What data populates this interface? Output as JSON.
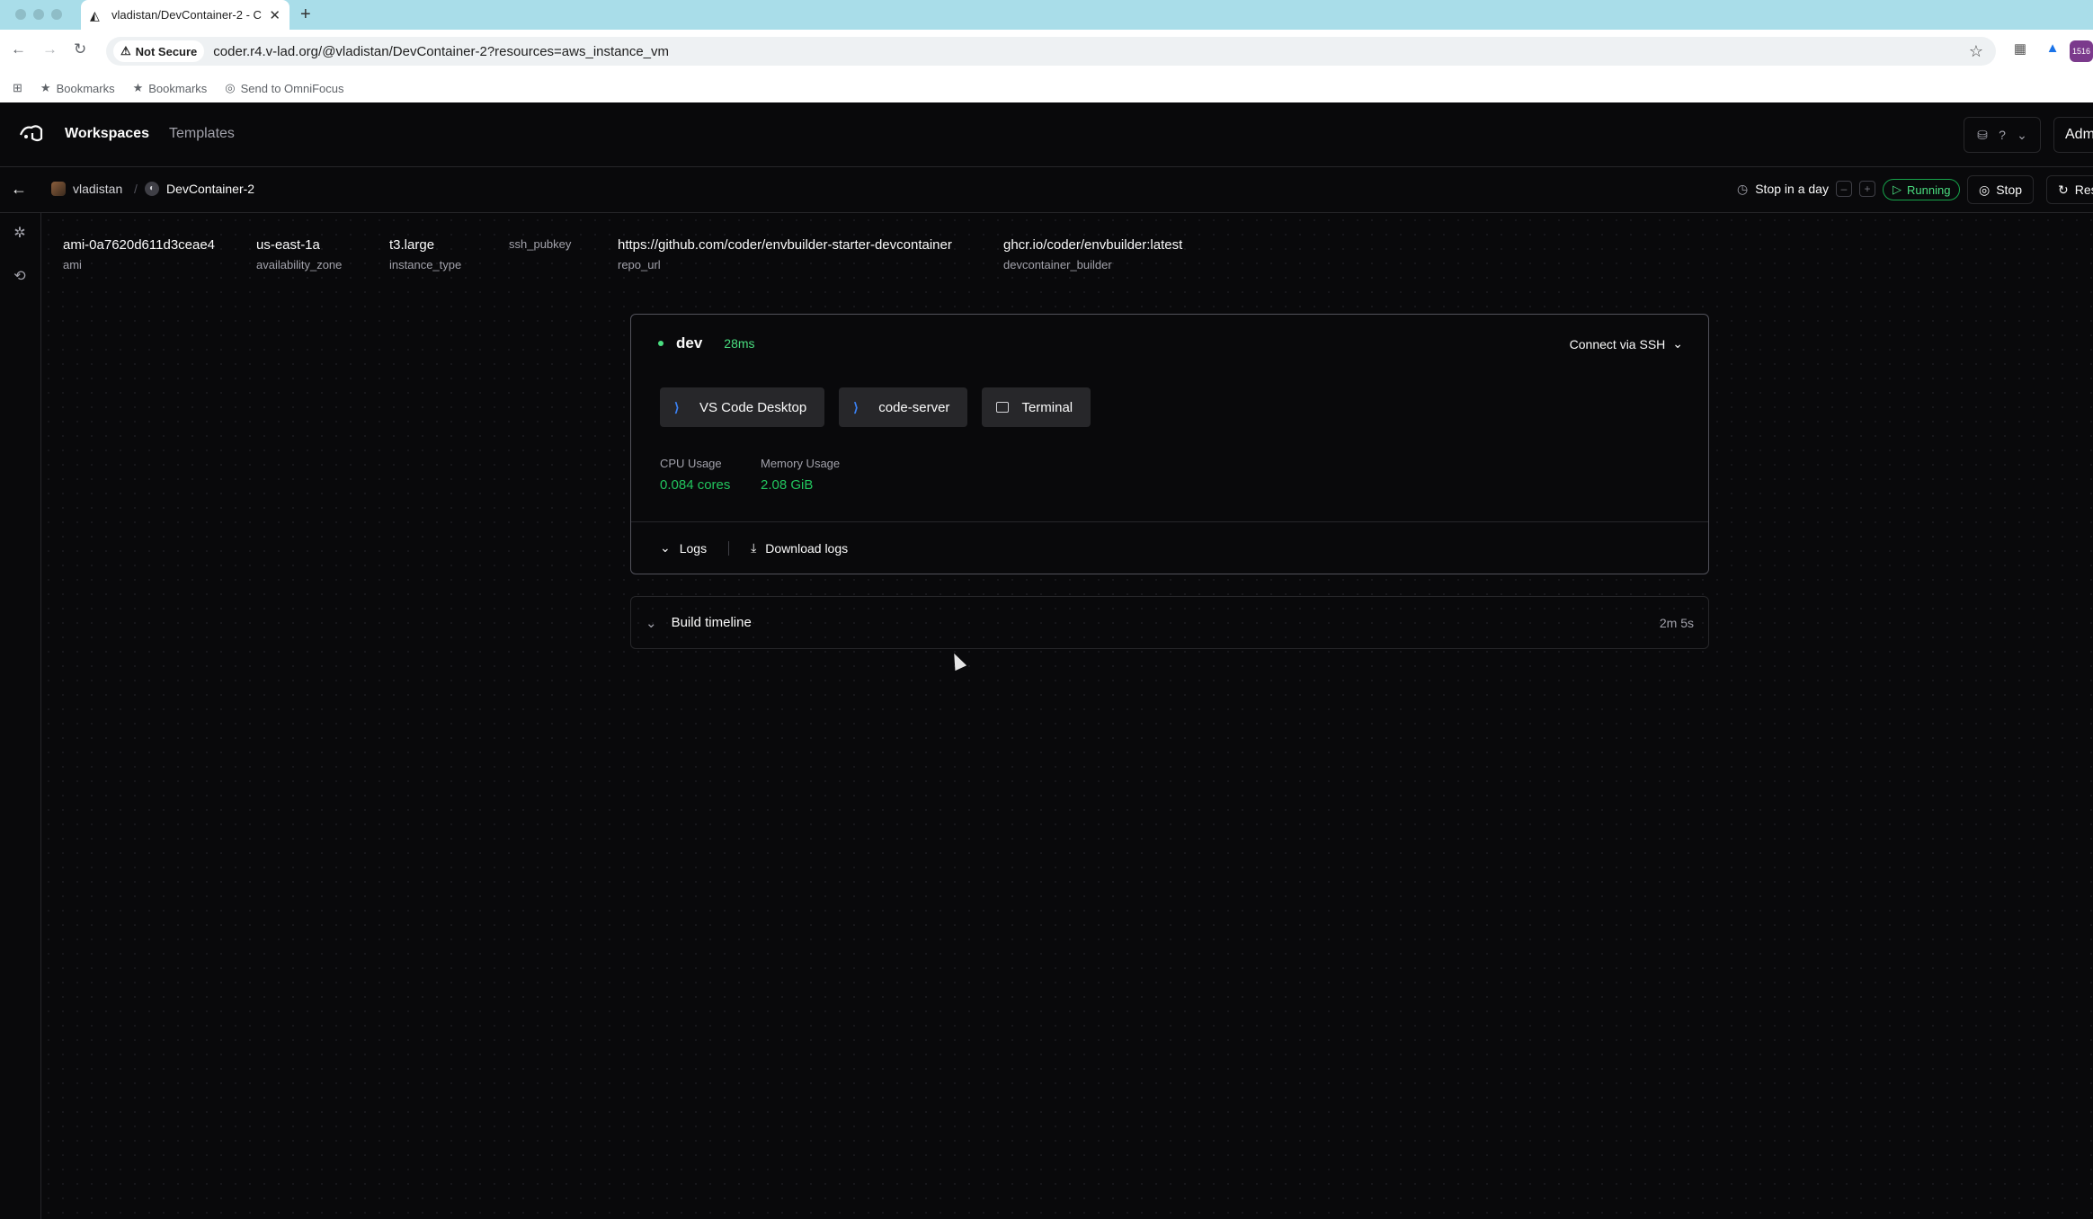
{
  "browser": {
    "tab_title": "vladistan/DevContainer-2 - C",
    "security_label": "Not Secure",
    "url": "coder.r4.v-lad.org/@vladistan/DevContainer-2?resources=aws_instance_vm",
    "extension_badge": "1516",
    "bookmarks": [
      {
        "label": "Bookmarks"
      },
      {
        "label": "Bookmarks"
      },
      {
        "label": "Send to OmniFocus"
      }
    ]
  },
  "nav": {
    "workspaces": "Workspaces",
    "templates": "Templates",
    "admin": "Admin"
  },
  "breadcrumb": {
    "owner": "vladistan",
    "separator": "/",
    "workspace": "DevContainer-2"
  },
  "actions": {
    "schedule": "Stop in a day",
    "minus": "–",
    "plus": "+",
    "status": "Running",
    "stop": "Stop",
    "restart": "Restart"
  },
  "metadata": [
    {
      "value": "ami-0a7620d611d3ceae4",
      "key": "ami"
    },
    {
      "value": "us-east-1a",
      "key": "availability_zone"
    },
    {
      "value": "t3.large",
      "key": "instance_type"
    },
    {
      "value": "",
      "key": "ssh_pubkey"
    },
    {
      "value": "https://github.com/coder/envbuilder-starter-devcontainer",
      "key": "repo_url"
    },
    {
      "value": "ghcr.io/coder/envbuilder:latest",
      "key": "devcontainer_builder"
    }
  ],
  "agent": {
    "name": "dev",
    "latency": "28ms",
    "connect": "Connect via SSH",
    "apps": [
      {
        "label": "VS Code Desktop",
        "icon": "vscode-icon"
      },
      {
        "label": "code-server",
        "icon": "vscode-icon"
      },
      {
        "label": "Terminal",
        "icon": "terminal-icon"
      }
    ],
    "cpu_label": "CPU Usage",
    "cpu_value": "0.084 cores",
    "mem_label": "Memory Usage",
    "mem_value": "2.08 GiB",
    "logs": "Logs",
    "download_logs": "Download logs"
  },
  "timeline": {
    "label": "Build timeline",
    "duration": "2m 5s"
  },
  "colors": {
    "background": "#09090b",
    "success": "#4ade80",
    "border": "#27272a"
  }
}
